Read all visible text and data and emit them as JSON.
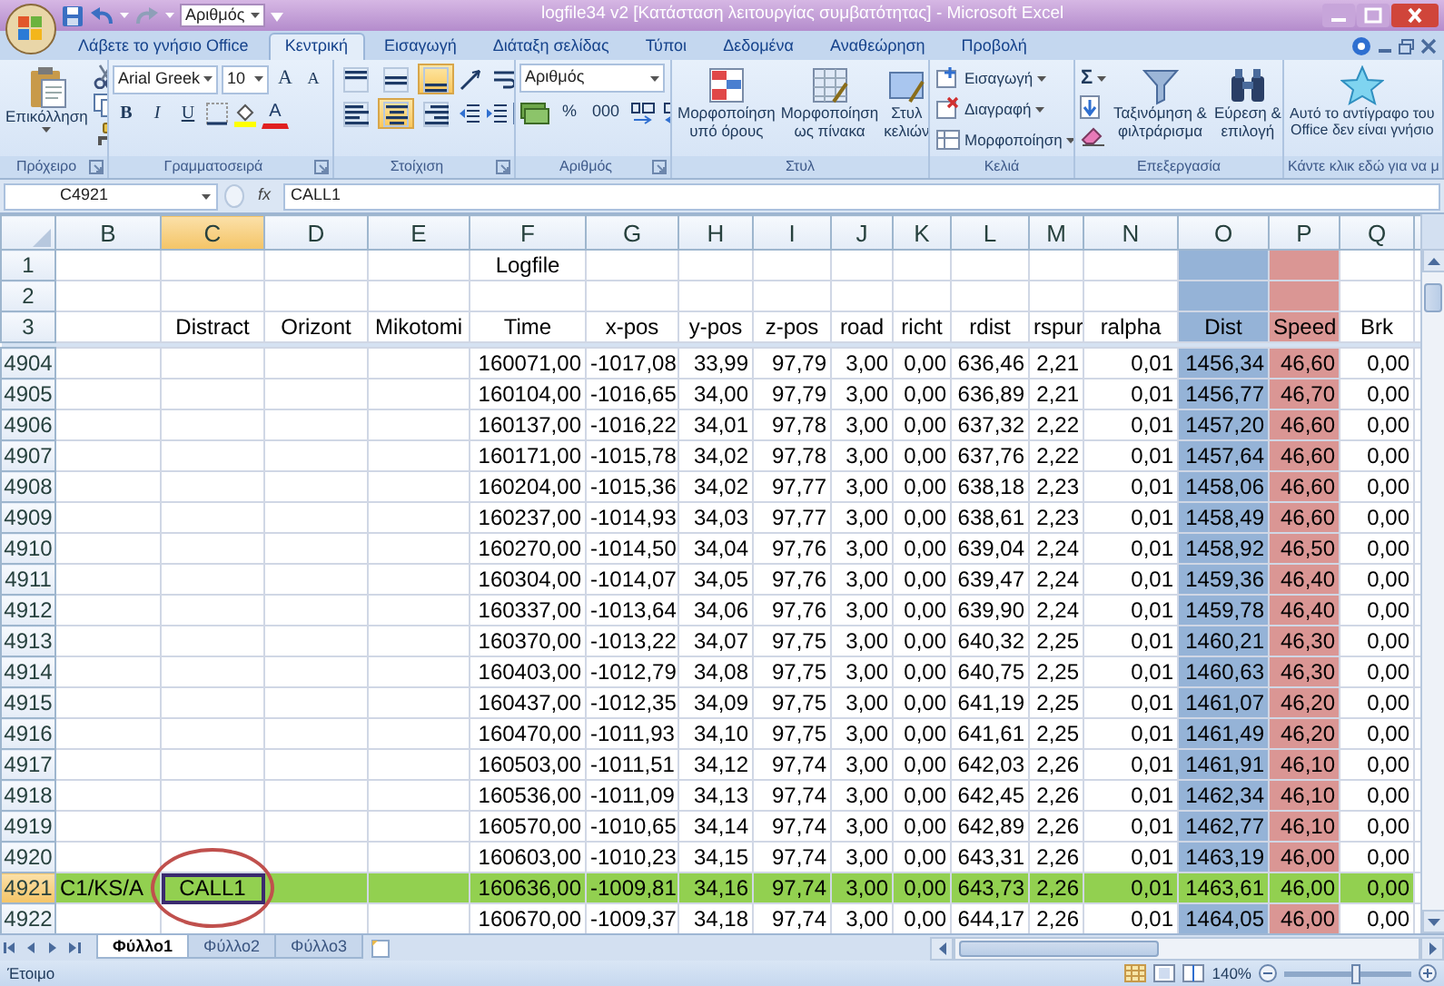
{
  "quick_access": {
    "combo": "Αριθμός"
  },
  "window": {
    "title": "logfile34 v2  [Κατάσταση λειτουργίας συμβατότητας] - Microsoft Excel"
  },
  "tabs": [
    {
      "label": "Λάβετε το γνήσιο Office",
      "selected": false
    },
    {
      "label": "Κεντρική",
      "selected": true
    },
    {
      "label": "Εισαγωγή",
      "selected": false
    },
    {
      "label": "Διάταξη σελίδας",
      "selected": false
    },
    {
      "label": "Τύποι",
      "selected": false
    },
    {
      "label": "Δεδομένα",
      "selected": false
    },
    {
      "label": "Αναθεώρηση",
      "selected": false
    },
    {
      "label": "Προβολή",
      "selected": false
    }
  ],
  "ribbon": [
    {
      "kind": "clipboard",
      "label": "Πρόχειρο",
      "launcher": true,
      "paste": "Επικόλληση"
    },
    {
      "kind": "font",
      "label": "Γραμματοσειρά",
      "launcher": true,
      "font": "Arial Greek",
      "size": "10",
      "size_buttons": [
        "A",
        "A"
      ],
      "style_buttons": [
        "B",
        "I",
        "U"
      ],
      "color_button": "A"
    },
    {
      "kind": "alignment",
      "label": "Στοίχιση",
      "launcher": true,
      "vertical": [
        {
          "kind": "top",
          "selected": false
        },
        {
          "kind": "middle",
          "selected": false
        },
        {
          "kind": "bottom",
          "selected": true
        }
      ],
      "horizontal": [
        {
          "kind": "left",
          "selected": false
        },
        {
          "kind": "center",
          "selected": true
        },
        {
          "kind": "right",
          "selected": false
        }
      ]
    },
    {
      "kind": "number",
      "label": "Αριθμός",
      "launcher": true,
      "format": "Αριθμός",
      "buttons": [
        "%",
        "000"
      ]
    },
    {
      "kind": "styles",
      "label": "Στυλ",
      "launcher": false,
      "buttons": [
        {
          "kind": "conditional",
          "lines": [
            "Μορφοποίηση",
            "υπό όρους"
          ]
        },
        {
          "kind": "table",
          "lines": [
            "Μορφοποίηση",
            "ως πίνακα"
          ]
        },
        {
          "kind": "cell",
          "lines": [
            "Στυλ",
            "κελιών"
          ]
        }
      ]
    },
    {
      "kind": "cells",
      "label": "Κελιά",
      "launcher": false,
      "buttons": [
        {
          "kind": "insert",
          "label": "Εισαγωγή"
        },
        {
          "kind": "delete",
          "label": "Διαγραφή"
        },
        {
          "kind": "format",
          "label": "Μορφοποίηση"
        }
      ]
    },
    {
      "kind": "editing",
      "label": "Επεξεργασία",
      "launcher": false,
      "sum": "Σ",
      "buttons": [
        {
          "kind": "sort",
          "lines": [
            "Ταξινόμηση &",
            "φιλτράρισμα"
          ]
        },
        {
          "kind": "find",
          "lines": [
            "Εύρεση &",
            "επιλογή"
          ]
        }
      ]
    },
    {
      "kind": "genuine",
      "label": "Κάντε κλικ εδώ για να μ",
      "launcher": false,
      "lines": [
        "Αυτό το αντίγραφο του",
        "Office δεν είναι γνήσιο"
      ]
    }
  ],
  "formula_bar": {
    "name_box": "C4921",
    "fx": "fx",
    "formula": "CALL1"
  },
  "sheet": {
    "active_cell_circled": true,
    "columns": [
      {
        "letter": "B",
        "selected": false
      },
      {
        "letter": "C",
        "selected": true
      },
      {
        "letter": "D",
        "selected": false
      },
      {
        "letter": "E",
        "selected": false
      },
      {
        "letter": "F",
        "selected": false
      },
      {
        "letter": "G",
        "selected": false
      },
      {
        "letter": "H",
        "selected": false
      },
      {
        "letter": "I",
        "selected": false
      },
      {
        "letter": "J",
        "selected": false
      },
      {
        "letter": "K",
        "selected": false
      },
      {
        "letter": "L",
        "selected": false
      },
      {
        "letter": "M",
        "selected": false
      },
      {
        "letter": "N",
        "selected": false
      },
      {
        "letter": "O",
        "selected": false,
        "color": "#95b3d7"
      },
      {
        "letter": "P",
        "selected": false,
        "color": "#da9694"
      },
      {
        "letter": "Q",
        "selected": false
      }
    ],
    "frozen_rows": [
      {
        "number": "1",
        "selected": false,
        "cells": [
          null,
          null,
          null,
          null,
          "Logfile",
          null,
          null,
          null,
          null,
          null,
          null,
          null,
          null,
          null,
          null,
          null
        ]
      },
      {
        "number": "2",
        "selected": false,
        "cells": [
          null,
          null,
          null,
          null,
          null,
          null,
          null,
          null,
          null,
          null,
          null,
          null,
          null,
          null,
          null,
          null
        ]
      },
      {
        "number": "3",
        "selected": false,
        "cells": [
          null,
          "Distract",
          "Orizont",
          "Mikotomi",
          "Time",
          "x-pos",
          "y-pos",
          "z-pos",
          "road",
          "richt",
          "rdist",
          "rspur",
          "ralpha",
          "Dist",
          "Speed",
          "Brk"
        ]
      }
    ],
    "rows": [
      {
        "number": "4904",
        "selected": false,
        "cells": [
          null,
          null,
          null,
          null,
          "160071,00",
          "-1017,08",
          "33,99",
          "97,79",
          "3,00",
          "0,00",
          "636,46",
          "2,21",
          "0,01",
          "1456,34",
          "46,60",
          "0,00"
        ]
      },
      {
        "number": "4905",
        "selected": false,
        "cells": [
          null,
          null,
          null,
          null,
          "160104,00",
          "-1016,65",
          "34,00",
          "97,79",
          "3,00",
          "0,00",
          "636,89",
          "2,21",
          "0,01",
          "1456,77",
          "46,70",
          "0,00"
        ]
      },
      {
        "number": "4906",
        "selected": false,
        "cells": [
          null,
          null,
          null,
          null,
          "160137,00",
          "-1016,22",
          "34,01",
          "97,78",
          "3,00",
          "0,00",
          "637,32",
          "2,22",
          "0,01",
          "1457,20",
          "46,60",
          "0,00"
        ]
      },
      {
        "number": "4907",
        "selected": false,
        "cells": [
          null,
          null,
          null,
          null,
          "160171,00",
          "-1015,78",
          "34,02",
          "97,78",
          "3,00",
          "0,00",
          "637,76",
          "2,22",
          "0,01",
          "1457,64",
          "46,60",
          "0,00"
        ]
      },
      {
        "number": "4908",
        "selected": false,
        "cells": [
          null,
          null,
          null,
          null,
          "160204,00",
          "-1015,36",
          "34,02",
          "97,77",
          "3,00",
          "0,00",
          "638,18",
          "2,23",
          "0,01",
          "1458,06",
          "46,60",
          "0,00"
        ]
      },
      {
        "number": "4909",
        "selected": false,
        "cells": [
          null,
          null,
          null,
          null,
          "160237,00",
          "-1014,93",
          "34,03",
          "97,77",
          "3,00",
          "0,00",
          "638,61",
          "2,23",
          "0,01",
          "1458,49",
          "46,60",
          "0,00"
        ]
      },
      {
        "number": "4910",
        "selected": false,
        "cells": [
          null,
          null,
          null,
          null,
          "160270,00",
          "-1014,50",
          "34,04",
          "97,76",
          "3,00",
          "0,00",
          "639,04",
          "2,24",
          "0,01",
          "1458,92",
          "46,50",
          "0,00"
        ]
      },
      {
        "number": "4911",
        "selected": false,
        "cells": [
          null,
          null,
          null,
          null,
          "160304,00",
          "-1014,07",
          "34,05",
          "97,76",
          "3,00",
          "0,00",
          "639,47",
          "2,24",
          "0,01",
          "1459,36",
          "46,40",
          "0,00"
        ]
      },
      {
        "number": "4912",
        "selected": false,
        "cells": [
          null,
          null,
          null,
          null,
          "160337,00",
          "-1013,64",
          "34,06",
          "97,76",
          "3,00",
          "0,00",
          "639,90",
          "2,24",
          "0,01",
          "1459,78",
          "46,40",
          "0,00"
        ]
      },
      {
        "number": "4913",
        "selected": false,
        "cells": [
          null,
          null,
          null,
          null,
          "160370,00",
          "-1013,22",
          "34,07",
          "97,75",
          "3,00",
          "0,00",
          "640,32",
          "2,25",
          "0,01",
          "1460,21",
          "46,30",
          "0,00"
        ]
      },
      {
        "number": "4914",
        "selected": false,
        "cells": [
          null,
          null,
          null,
          null,
          "160403,00",
          "-1012,79",
          "34,08",
          "97,75",
          "3,00",
          "0,00",
          "640,75",
          "2,25",
          "0,01",
          "1460,63",
          "46,30",
          "0,00"
        ]
      },
      {
        "number": "4915",
        "selected": false,
        "cells": [
          null,
          null,
          null,
          null,
          "160437,00",
          "-1012,35",
          "34,09",
          "97,75",
          "3,00",
          "0,00",
          "641,19",
          "2,25",
          "0,01",
          "1461,07",
          "46,20",
          "0,00"
        ]
      },
      {
        "number": "4916",
        "selected": false,
        "cells": [
          null,
          null,
          null,
          null,
          "160470,00",
          "-1011,93",
          "34,10",
          "97,75",
          "3,00",
          "0,00",
          "641,61",
          "2,25",
          "0,01",
          "1461,49",
          "46,20",
          "0,00"
        ]
      },
      {
        "number": "4917",
        "selected": false,
        "cells": [
          null,
          null,
          null,
          null,
          "160503,00",
          "-1011,51",
          "34,12",
          "97,74",
          "3,00",
          "0,00",
          "642,03",
          "2,26",
          "0,01",
          "1461,91",
          "46,10",
          "0,00"
        ]
      },
      {
        "number": "4918",
        "selected": false,
        "cells": [
          null,
          null,
          null,
          null,
          "160536,00",
          "-1011,09",
          "34,13",
          "97,74",
          "3,00",
          "0,00",
          "642,45",
          "2,26",
          "0,01",
          "1462,34",
          "46,10",
          "0,00"
        ]
      },
      {
        "number": "4919",
        "selected": false,
        "cells": [
          null,
          null,
          null,
          null,
          "160570,00",
          "-1010,65",
          "34,14",
          "97,74",
          "3,00",
          "0,00",
          "642,89",
          "2,26",
          "0,01",
          "1462,77",
          "46,10",
          "0,00"
        ]
      },
      {
        "number": "4920",
        "selected": false,
        "cells": [
          null,
          null,
          null,
          null,
          "160603,00",
          "-1010,23",
          "34,15",
          "97,74",
          "3,00",
          "0,00",
          "643,31",
          "2,26",
          "0,01",
          "1463,19",
          "46,00",
          "0,00"
        ]
      },
      {
        "number": "4921",
        "selected": true,
        "color": "#92d050",
        "cells": [
          "C1/KS/A",
          "CALL1",
          null,
          null,
          "160636,00",
          "-1009,81",
          "34,16",
          "97,74",
          "3,00",
          "0,00",
          "643,73",
          "2,26",
          "0,01",
          "1463,61",
          "46,00",
          "0,00"
        ]
      },
      {
        "number": "4922",
        "selected": false,
        "cells": [
          null,
          null,
          null,
          null,
          "160670,00",
          "-1009,37",
          "34,18",
          "97,74",
          "3,00",
          "0,00",
          "644,17",
          "2,26",
          "0,01",
          "1464,05",
          "46,00",
          "0,00"
        ]
      }
    ]
  },
  "sheet_tabs": [
    {
      "label": "Φύλλο1",
      "selected": true
    },
    {
      "label": "Φύλλο2",
      "selected": false
    },
    {
      "label": "Φύλλο3",
      "selected": false
    }
  ],
  "status_bar": {
    "text": "Έτοιμο",
    "zoom": "140%",
    "level": 0.57
  }
}
